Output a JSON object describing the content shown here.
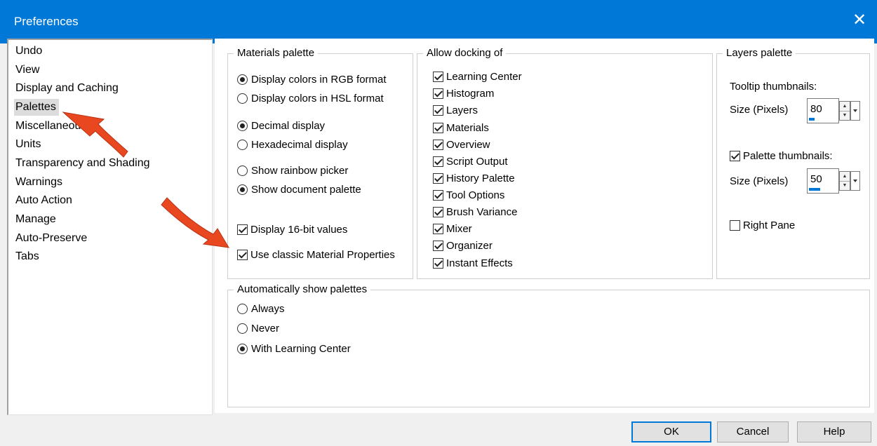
{
  "window": {
    "title": "Preferences",
    "close_icon": "close-icon"
  },
  "categories": [
    {
      "label": "Undo"
    },
    {
      "label": "View"
    },
    {
      "label": "Display and Caching"
    },
    {
      "label": "Palettes",
      "selected": true
    },
    {
      "label": "Miscellaneous"
    },
    {
      "label": "Units"
    },
    {
      "label": "Transparency and Shading"
    },
    {
      "label": "Warnings"
    },
    {
      "label": "Auto Action"
    },
    {
      "label": "Manage"
    },
    {
      "label": "Auto-Preserve"
    },
    {
      "label": "Tabs"
    }
  ],
  "materials": {
    "title": "Materials palette",
    "options": [
      {
        "label": "Display colors in RGB format",
        "type": "radio",
        "checked": true
      },
      {
        "label": "Display colors in HSL format",
        "type": "radio",
        "checked": false
      },
      {
        "label": "Decimal display",
        "type": "radio",
        "checked": true
      },
      {
        "label": "Hexadecimal display",
        "type": "radio",
        "checked": false
      },
      {
        "label": "Show rainbow picker",
        "type": "radio",
        "checked": false
      },
      {
        "label": "Show document palette",
        "type": "radio",
        "checked": true
      },
      {
        "label": "Display 16-bit values",
        "type": "checkbox",
        "checked": true
      },
      {
        "label": "Use classic Material Properties",
        "type": "checkbox",
        "checked": true
      }
    ]
  },
  "docking": {
    "title": "Allow docking of",
    "items": [
      {
        "label": "Learning Center",
        "checked": true
      },
      {
        "label": "Histogram",
        "checked": true
      },
      {
        "label": "Layers",
        "checked": true
      },
      {
        "label": "Materials",
        "checked": true
      },
      {
        "label": "Overview",
        "checked": true
      },
      {
        "label": "Script Output",
        "checked": true
      },
      {
        "label": "History Palette",
        "checked": true
      },
      {
        "label": "Tool Options",
        "checked": true
      },
      {
        "label": "Brush Variance",
        "checked": true
      },
      {
        "label": "Mixer",
        "checked": true
      },
      {
        "label": "Organizer",
        "checked": true
      },
      {
        "label": "Instant Effects",
        "checked": true
      }
    ]
  },
  "layers": {
    "title": "Layers palette",
    "tooltip_label": "Tooltip thumbnails:",
    "size_label_1": "Size (Pixels)",
    "size_value_1": "80",
    "size_level_1": 0.2,
    "palette_thumbs_label": "Palette thumbnails:",
    "palette_thumbs_checked": true,
    "size_label_2": "Size (Pixels)",
    "size_value_2": "50",
    "size_level_2": 0.4,
    "right_pane_label": "Right Pane",
    "right_pane_checked": false
  },
  "auto_show": {
    "title": "Automatically show palettes",
    "options": [
      {
        "label": "Always",
        "checked": false
      },
      {
        "label": "Never",
        "checked": false
      },
      {
        "label": "With Learning Center",
        "checked": true
      }
    ]
  },
  "buttons": {
    "ok": "OK",
    "cancel": "Cancel",
    "help": "Help"
  },
  "annotation_color": "#e8471f"
}
